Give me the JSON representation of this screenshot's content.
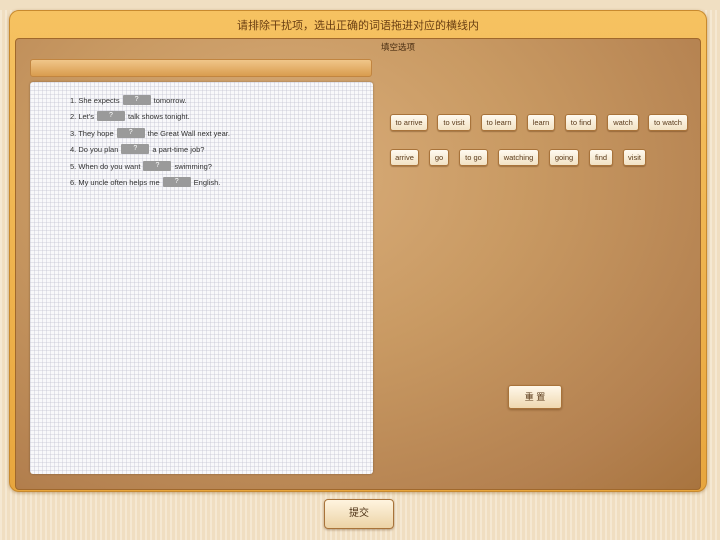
{
  "header": {
    "title": "请排除干扰项，选出正确的词语拖进对应的横线内"
  },
  "questions": [
    {
      "prefix": "1. She expects",
      "blank": "?",
      "suffix": "tomorrow."
    },
    {
      "prefix": "2. Let's",
      "blank": "?",
      "suffix": "talk shows tonight."
    },
    {
      "prefix": "3. They hope",
      "blank": "?",
      "suffix": "the Great Wall next year."
    },
    {
      "prefix": "4. Do you plan",
      "blank": "?",
      "suffix": "a part-time job?"
    },
    {
      "prefix": "5. When do you want",
      "blank": "?",
      "suffix": "swimming?"
    },
    {
      "prefix": "6. My uncle often helps me",
      "blank": "?",
      "suffix": "English."
    }
  ],
  "options_panel": {
    "label": "填空选项",
    "row1": [
      "to arrive",
      "to visit",
      "to learn",
      "learn",
      "to find",
      "watch",
      "to watch"
    ],
    "row2": [
      "arrive",
      "go",
      "to go",
      "watching",
      "going",
      "find",
      "visit"
    ]
  },
  "buttons": {
    "reset": "重 置",
    "submit": "提交"
  }
}
